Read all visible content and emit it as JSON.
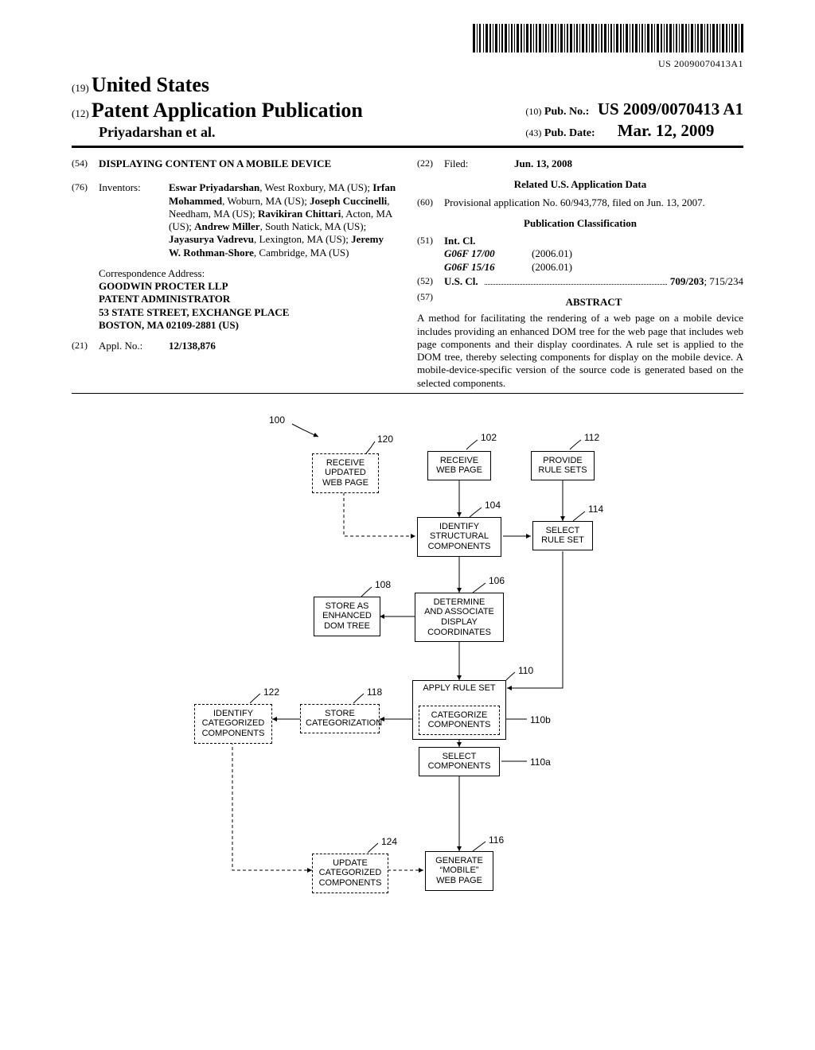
{
  "barcode_text": "US 20090070413A1",
  "header": {
    "code19": "(19)",
    "country": "United States",
    "code12": "(12)",
    "pub_type": "Patent Application Publication",
    "authors_line": "Priyadarshan et al.",
    "code10": "(10)",
    "pub_no_label": "Pub. No.:",
    "pub_no": "US 2009/0070413 A1",
    "code43": "(43)",
    "pub_date_label": "Pub. Date:",
    "pub_date": "Mar. 12, 2009"
  },
  "left": {
    "code54": "(54)",
    "title": "DISPLAYING CONTENT ON A MOBILE DEVICE",
    "code76": "(76)",
    "inventors_label": "Inventors:",
    "inventors_html": "<b>Eswar Priyadarshan</b>, West Roxbury, MA (US); <b>Irfan Mohammed</b>, Woburn, MA (US); <b>Joseph Cuccinelli</b>, Needham, MA (US); <b>Ravikiran Chittari</b>, Acton, MA (US); <b>Andrew Miller</b>, South Natick, MA (US); <b>Jayasurya Vadrevu</b>, Lexington, MA (US); <b>Jeremy W. Rothman-Shore</b>, Cambridge, MA (US)",
    "corr_label": "Correspondence Address:",
    "corr_1": "GOODWIN PROCTER LLP",
    "corr_2": "PATENT ADMINISTRATOR",
    "corr_3": "53 STATE STREET, EXCHANGE PLACE",
    "corr_4": "BOSTON, MA 02109-2881 (US)",
    "code21": "(21)",
    "appl_label": "Appl. No.:",
    "appl_no": "12/138,876"
  },
  "right": {
    "code22": "(22)",
    "filed_label": "Filed:",
    "filed": "Jun. 13, 2008",
    "related_head": "Related U.S. Application Data",
    "code60": "(60)",
    "provisional": "Provisional application No. 60/943,778, filed on Jun. 13, 2007.",
    "class_head": "Publication Classification",
    "code51": "(51)",
    "intcl_label": "Int. Cl.",
    "ipc": [
      {
        "code": "G06F 17/00",
        "ver": "(2006.01)"
      },
      {
        "code": "G06F 15/16",
        "ver": "(2006.01)"
      }
    ],
    "code52": "(52)",
    "uscl_label": "U.S. Cl.",
    "uscl_val_html": "<b>709/203</b>; 715/234",
    "code57": "(57)",
    "abstract_label": "ABSTRACT",
    "abstract": "A method for facilitating the rendering of a web page on a mobile device includes providing an enhanced DOM tree for the web page that includes web page components and their display coordinates. A rule set is applied to the DOM tree, thereby selecting components for display on the mobile device. A mobile-device-specific version of the source code is generated based on the selected components."
  },
  "figure": {
    "ref100": "100",
    "boxes": {
      "b120": {
        "ref": "120",
        "text": "RECEIVE\nUPDATED\nWEB PAGE"
      },
      "b102": {
        "ref": "102",
        "text": "RECEIVE\nWEB PAGE"
      },
      "b112": {
        "ref": "112",
        "text": "PROVIDE\nRULE SETS"
      },
      "b104": {
        "ref": "104",
        "text": "IDENTIFY\nSTRUCTURAL\nCOMPONENTS"
      },
      "b114": {
        "ref": "114",
        "text": "SELECT\nRULE SET"
      },
      "b106": {
        "ref": "106",
        "text": "DETERMINE\nAND ASSOCIATE\nDISPLAY\nCOORDINATES"
      },
      "b108": {
        "ref": "108",
        "text": "STORE AS\nENHANCED\nDOM TREE"
      },
      "b110t": {
        "ref": "110",
        "text": "APPLY RULE SET"
      },
      "b110b": {
        "ref": "110b",
        "text": "CATEGORIZE\nCOMPONENTS"
      },
      "b110a": {
        "ref": "110a",
        "text": "SELECT\nCOMPONENTS"
      },
      "b118": {
        "ref": "118",
        "text": "STORE\nCATEGORIZATION"
      },
      "b122": {
        "ref": "122",
        "text": "IDENTIFY\nCATEGORIZED\nCOMPONENTS"
      },
      "b116": {
        "ref": "116",
        "text": "GENERATE\n“MOBILE”\nWEB PAGE"
      },
      "b124": {
        "ref": "124",
        "text": "UPDATE\nCATEGORIZED\nCOMPONENTS"
      }
    }
  }
}
